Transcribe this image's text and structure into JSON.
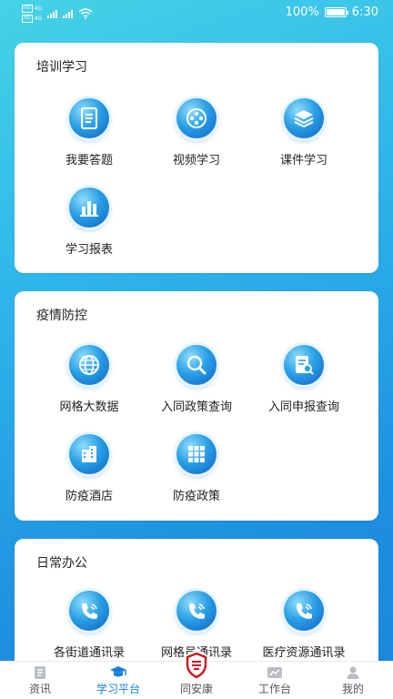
{
  "status_bar": {
    "sim1": "HD",
    "sim1_net": "4G",
    "sim2": "HD",
    "sim2_net": "4G",
    "battery": "100%",
    "time": "6:30"
  },
  "sections": [
    {
      "title": "培训学习",
      "items": [
        {
          "label": "我要答题",
          "icon": "document-icon"
        },
        {
          "label": "视频学习",
          "icon": "film-reel-icon"
        },
        {
          "label": "课件学习",
          "icon": "stack-books-icon"
        },
        {
          "label": "学习报表",
          "icon": "bar-chart-icon"
        }
      ]
    },
    {
      "title": "疫情防控",
      "items": [
        {
          "label": "网格大数据",
          "icon": "globe-icon"
        },
        {
          "label": "入同政策查询",
          "icon": "search-icon"
        },
        {
          "label": "入同申报查询",
          "icon": "doc-search-icon"
        },
        {
          "label": "防疫酒店",
          "icon": "building-icon"
        },
        {
          "label": "防疫政策",
          "icon": "grid-icon"
        }
      ]
    },
    {
      "title": "日常办公",
      "items": [
        {
          "label": "各街道通讯录",
          "icon": "phone-icon"
        },
        {
          "label": "网格员通讯录",
          "icon": "phone-icon"
        },
        {
          "label": "医疗资源通讯录",
          "icon": "phone-icon"
        }
      ]
    }
  ],
  "tabbar": {
    "tabs": [
      {
        "label": "资讯",
        "icon": "news-icon"
      },
      {
        "label": "学习平台",
        "icon": "graduation-cap-icon",
        "active": true
      },
      {
        "label": "同安康",
        "icon": "shield-badge-icon"
      },
      {
        "label": "工作台",
        "icon": "trend-icon"
      },
      {
        "label": "我的",
        "icon": "user-icon"
      }
    ]
  },
  "colors": {
    "accent": "#1a7fd9",
    "bg_top": "#46d2e6",
    "bg_bottom": "#1a86dc",
    "badge_red": "#c8161d"
  }
}
